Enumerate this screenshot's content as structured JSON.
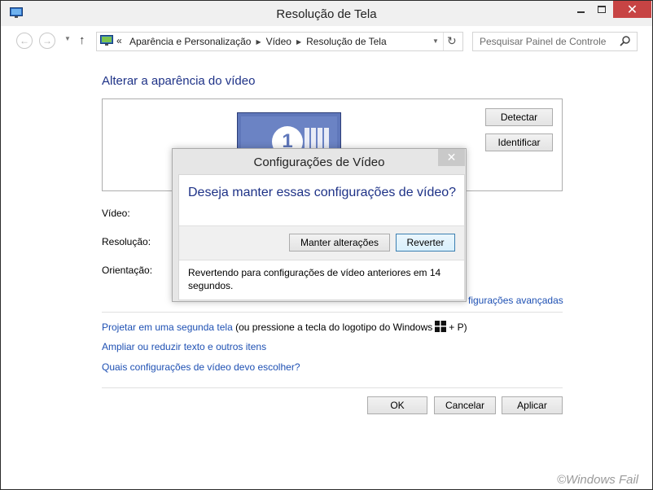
{
  "window": {
    "title": "Resolução de Tela",
    "close_glyph": "✕"
  },
  "navigation": {
    "back_glyph": "←",
    "forward_glyph": "→",
    "up_glyph": "↑",
    "overflow_glyph": "«",
    "breadcrumbs": [
      "Aparência e Personalização",
      "Vídeo",
      "Resolução de Tela"
    ],
    "separator_glyph": "▶",
    "refresh_glyph": "↻",
    "search_placeholder": "Pesquisar Painel de Controle"
  },
  "main": {
    "heading": "Alterar a aparência do vídeo",
    "monitor_number": "1",
    "detect_label": "Detectar",
    "identify_label": "Identificar",
    "video_label": "Vídeo:",
    "resolution_label": "Resolução:",
    "orientation_label": "Orientação:",
    "advanced_link": "figurações avançadas",
    "project_link": "Projetar em uma segunda tela",
    "project_text_before": "(ou pressione a tecla do logotipo do Windows",
    "project_text_after": "+ P)",
    "enlarge_link": "Ampliar ou reduzir texto e outros itens",
    "which_link": "Quais configurações de vídeo devo escolher?"
  },
  "footer": {
    "ok_label": "OK",
    "cancel_label": "Cancelar",
    "apply_label": "Aplicar"
  },
  "dialog": {
    "title": "Configurações de Vídeo",
    "question": "Deseja manter essas configurações de vídeo?",
    "keep_label": "Manter alterações",
    "revert_label": "Reverter",
    "message": "Revertendo para configurações de vídeo anteriores em 14 segundos."
  },
  "watermark": "©Windows Fail",
  "colors": {
    "accent_heading": "#1e3287",
    "link": "#1e50b3",
    "close_button": "#c74444",
    "monitor": "#5f77ba"
  }
}
